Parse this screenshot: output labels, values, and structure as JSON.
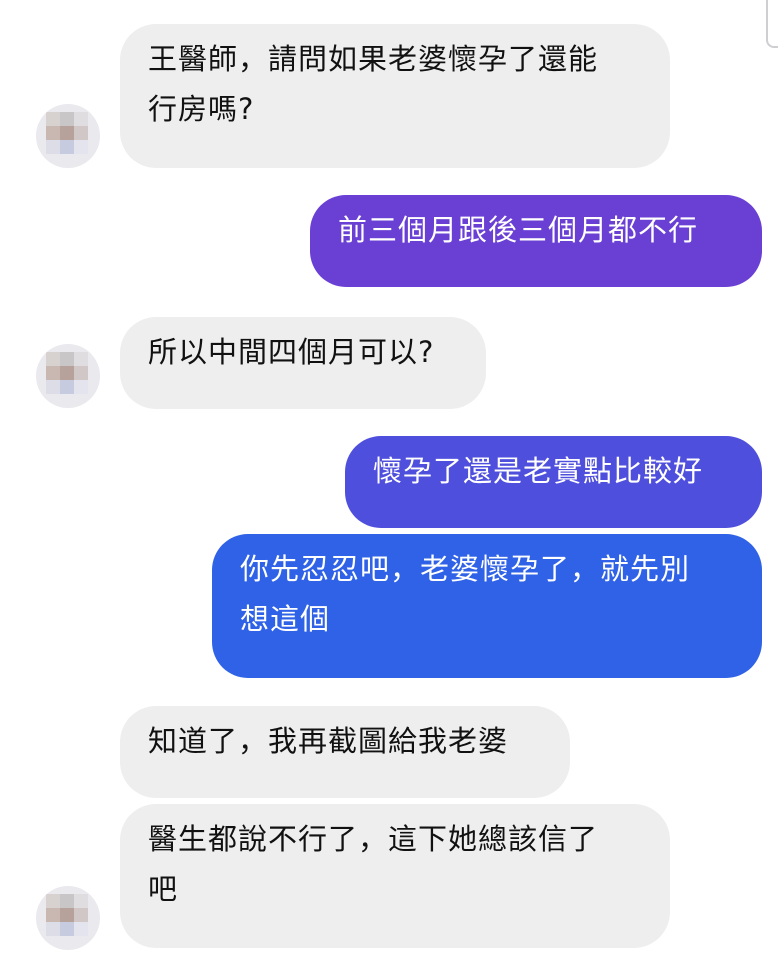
{
  "messages": [
    {
      "side": "incoming",
      "text": "王醫師，請問如果老婆懷孕了還能\n行房嗎?"
    },
    {
      "side": "outgoing",
      "text": "前三個月跟後三個月都不行",
      "color": "#6a3fd3"
    },
    {
      "side": "incoming",
      "text": "所以中間四個月可以?"
    },
    {
      "side": "outgoing",
      "text": "懷孕了還是老實點比較好",
      "color": "#4f4fdd"
    },
    {
      "side": "outgoing",
      "text": "你先忍忍吧，老婆懷孕了，就先別\n想這個",
      "color": "#2f62e6"
    },
    {
      "side": "incoming",
      "text": "知道了，我再截圖給我老婆"
    },
    {
      "side": "incoming",
      "text": "醫生都說不行了，這下她總該信了\n吧"
    }
  ],
  "colors": {
    "incoming_bubble": "#eeeeef",
    "incoming_text": "#111111",
    "outgoing_text": "#ffffff"
  },
  "icons": {
    "avatar": "pixelated-avatar-icon"
  }
}
